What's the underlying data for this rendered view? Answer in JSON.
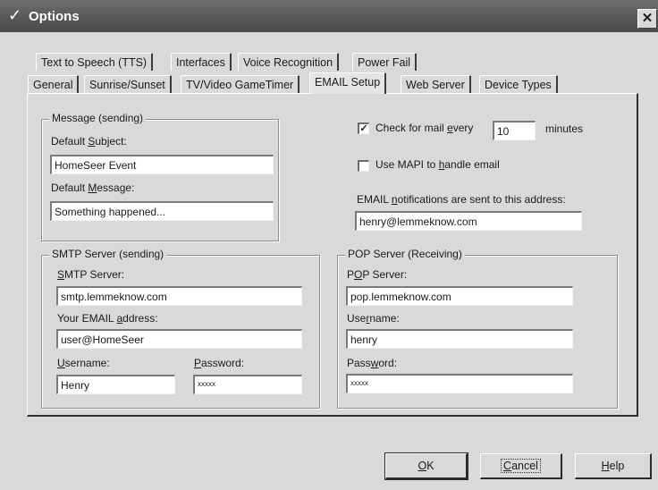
{
  "window": {
    "title": "Options",
    "title_check_glyph": "✓",
    "close_glyph": "✕"
  },
  "tabs_row1": [
    {
      "label": "Text to Speech (TTS)"
    },
    {
      "label": "Interfaces"
    },
    {
      "label": "Voice Recognition"
    },
    {
      "label": "Power Fail"
    }
  ],
  "tabs_row2": [
    {
      "label": "General"
    },
    {
      "label": "Sunrise/Sunset"
    },
    {
      "label": "TV/Video GameTimer"
    },
    {
      "label": "EMAIL Setup",
      "active": true
    },
    {
      "label": "Web Server"
    },
    {
      "label": "Device Types"
    }
  ],
  "message_group": {
    "legend": "Message (sending)",
    "subject_label_pre": "Default ",
    "subject_label_ul": "S",
    "subject_label_post": "ubject:",
    "subject_value": "HomeSeer Event",
    "message_label_pre": "Default ",
    "message_label_ul": "M",
    "message_label_post": "essage:",
    "message_value": "Something happened..."
  },
  "mail_check": {
    "checked": true,
    "check_glyph": "✓",
    "label_pre": "Check for mail ",
    "label_ul": "e",
    "label_post": "very",
    "interval_value": "10",
    "unit_label": "minutes"
  },
  "mapi": {
    "checked": false,
    "label_pre": "Use MAPI to ",
    "label_ul": "h",
    "label_post": "andle email"
  },
  "notifications": {
    "label_pre": "EMAIL ",
    "label_ul": "n",
    "label_post": "otifications are sent to this address:",
    "value": "henry@lemmeknow.com"
  },
  "smtp_group": {
    "legend": "SMTP Server (sending)",
    "server_label_pre": "",
    "server_label_ul": "S",
    "server_label_post": "MTP Server:",
    "server_value": "smtp.lemmeknow.com",
    "email_label_pre": "Your EMAIL ",
    "email_label_ul": "a",
    "email_label_post": "ddress:",
    "email_value": "user@HomeSeer",
    "username_label_pre": "",
    "username_label_ul": "U",
    "username_label_post": "sername:",
    "username_value": "Henry",
    "password_label_pre": "",
    "password_label_ul": "P",
    "password_label_post": "assword:",
    "password_value": "xxxxx"
  },
  "pop_group": {
    "legend": "POP Server (Receiving)",
    "server_label_pre": "P",
    "server_label_ul": "O",
    "server_label_post": "P Server:",
    "server_value": "pop.lemmeknow.com",
    "username_label_pre": "Use",
    "username_label_ul": "r",
    "username_label_post": "name:",
    "username_value": "henry",
    "password_label_pre": "Pass",
    "password_label_ul": "w",
    "password_label_post": "ord:",
    "password_value": "xxxxx"
  },
  "buttons": {
    "ok_ul": "O",
    "ok_post": "K",
    "cancel_ul": "C",
    "cancel_post": "ancel",
    "help_ul": "H",
    "help_post": "elp"
  }
}
